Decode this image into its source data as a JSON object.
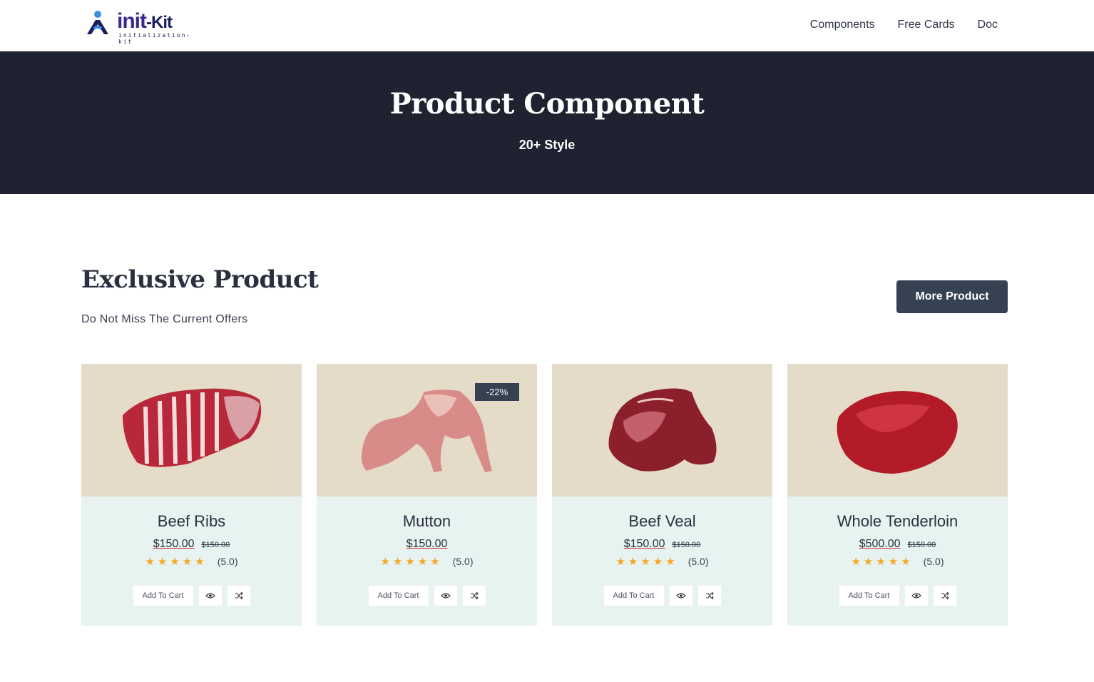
{
  "header": {
    "logo_text": "init",
    "logo_kit": "-Kit",
    "logo_sub": "initialization-kit",
    "nav": [
      "Components",
      "Free Cards",
      "Doc"
    ]
  },
  "hero": {
    "title": "Product Component",
    "subtitle": "20+ Style"
  },
  "section": {
    "title": "Exclusive Product",
    "subtitle": "Do Not Miss The Current Offers",
    "more_button": "More Product"
  },
  "products": [
    {
      "name": "Beef Ribs",
      "price": "$150.00",
      "old_price": "$150.00",
      "stars": "★★★★★",
      "rating": "(5.0)",
      "badge": "",
      "add_to_cart": "Add To Cart",
      "view_icon": "eye-icon",
      "compare_icon": "shuffle-icon"
    },
    {
      "name": "Mutton",
      "price": "$150.00",
      "old_price": "",
      "stars": "★★★★★",
      "rating": "(5.0)",
      "badge": "-22%",
      "add_to_cart": "Add To Cart",
      "view_icon": "eye-icon",
      "compare_icon": "shuffle-icon"
    },
    {
      "name": "Beef Veal",
      "price": "$150.00",
      "old_price": "$150.00",
      "stars": "★★★★★",
      "rating": "(5.0)",
      "badge": "",
      "add_to_cart": "Add To Cart",
      "view_icon": "eye-icon",
      "compare_icon": "shuffle-icon"
    },
    {
      "name": "Whole Tenderloin",
      "price": "$500.00",
      "old_price": "$150.00",
      "stars": "★★★★★",
      "rating": "(5.0)",
      "badge": "",
      "add_to_cart": "Add To Cart",
      "view_icon": "eye-icon",
      "compare_icon": "shuffle-icon"
    }
  ],
  "colors": {
    "hero_bg": "#1f2331",
    "accent": "#364152",
    "card_bg": "#e6f3f0",
    "image_bg": "#e4dcc8",
    "star": "#f5a623"
  }
}
